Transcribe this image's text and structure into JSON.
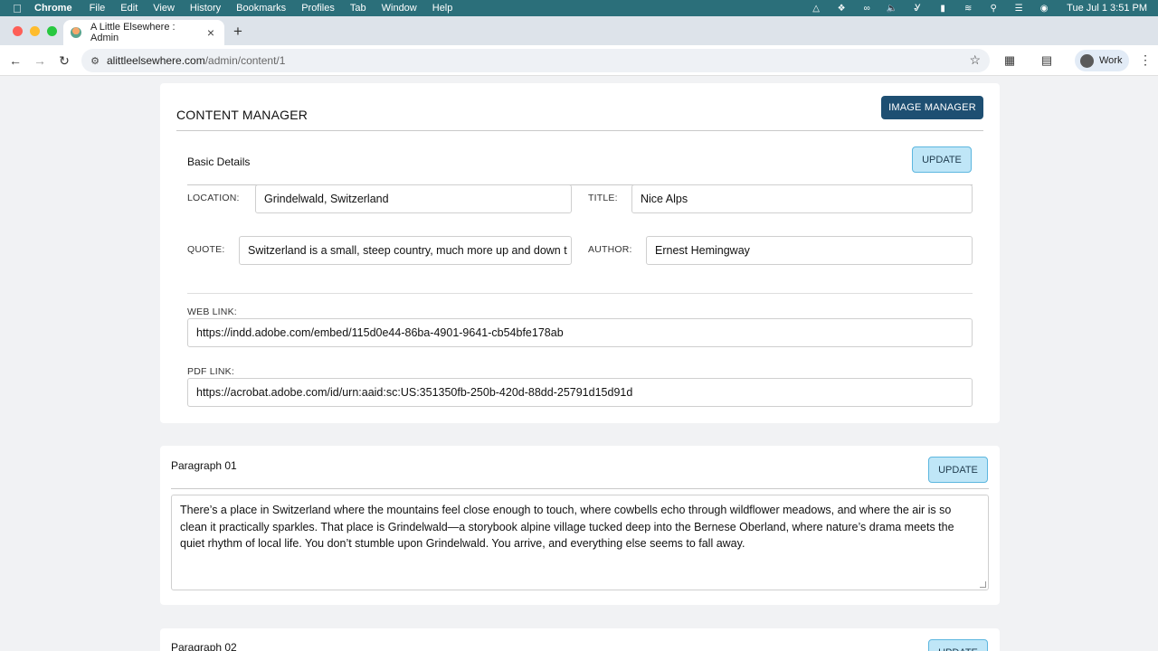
{
  "menubar": {
    "app": "Chrome",
    "items": [
      "File",
      "Edit",
      "View",
      "History",
      "Bookmarks",
      "Profiles",
      "Tab",
      "Window",
      "Help"
    ],
    "clock": "Tue Jul 1  3:51 PM"
  },
  "browser": {
    "tab_title": "A Little Elsewhere : Admin",
    "url_host": "alittleelsewhere.com",
    "url_path": "/admin/content/1",
    "profile_label": "Work"
  },
  "content_manager": {
    "title": "CONTENT MANAGER",
    "image_manager_label": "IMAGE MANAGER"
  },
  "basic_details": {
    "title": "Basic Details",
    "update_label": "UPDATE",
    "location_label": "LOCATION:",
    "location_value": "Grindelwald, Switzerland",
    "title_label": "TITLE:",
    "title_value": "Nice Alps",
    "quote_label": "QUOTE:",
    "quote_value": "Switzerland is a small, steep country, much more up and down t",
    "author_label": "AUTHOR:",
    "author_value": "Ernest Hemingway",
    "web_link_label": "WEB LINK:",
    "web_link_value": "https://indd.adobe.com/embed/115d0e44-86ba-4901-9641-cb54bfe178ab",
    "pdf_link_label": "PDF LINK:",
    "pdf_link_value": "https://acrobat.adobe.com/id/urn:aaid:sc:US:351350fb-250b-420d-88dd-25791d15d91d"
  },
  "paragraph_01": {
    "title": "Paragraph 01",
    "update_label": "UPDATE",
    "text": "There’s a place in Switzerland where the mountains feel close enough to touch, where cowbells echo through wildflower meadows, and where the air is so clean it practically sparkles. That place is Grindelwald—a storybook alpine village tucked deep into the Bernese Oberland, where nature’s drama meets the quiet rhythm of local life. You don’t stumble upon Grindelwald. You arrive, and everything else seems to fall away."
  },
  "paragraph_02": {
    "title": "Paragraph 02",
    "update_label": "UPDATE"
  },
  "colors": {
    "menubar": "#2b6f7a",
    "primary_button": "#1e4f72",
    "update_button": "#bfe6f7",
    "update_border": "#5cb6df"
  }
}
